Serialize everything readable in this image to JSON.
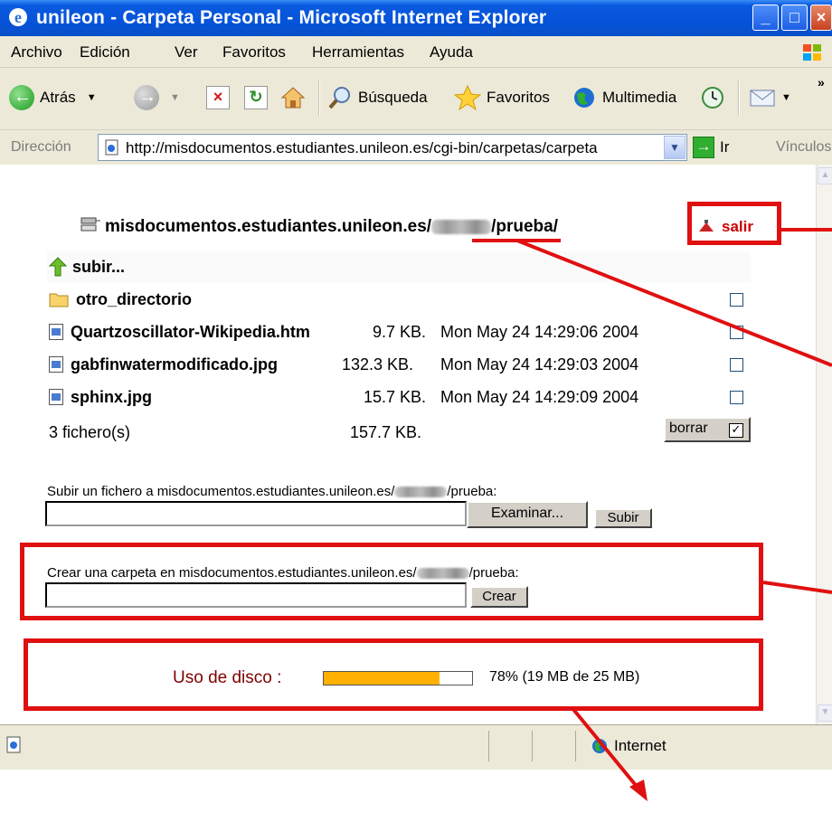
{
  "window": {
    "title": "unileon - Carpeta Personal - Microsoft Internet Explorer"
  },
  "menu": [
    "Archivo",
    "Edición",
    "Ver",
    "Favoritos",
    "Herramientas",
    "Ayuda"
  ],
  "toolbar": {
    "back": "Atrás",
    "search": "Búsqueda",
    "favorites": "Favoritos",
    "media": "Multimedia"
  },
  "address": {
    "label": "Dirección",
    "url": "http://misdocumentos.estudiantes.unileon.es/cgi-bin/carpetas/carpeta",
    "go": "Ir",
    "links": "Vínculos"
  },
  "page": {
    "path_prefix": "misdocumentos.estudiantes.unileon.es/",
    "path_suffix": "/prueba/",
    "logout": "salir",
    "up": "subir...",
    "folder": "otro_directorio",
    "files": [
      {
        "name": "Quartzoscillator-Wikipedia.htm",
        "size": "9.7 KB.",
        "date": "Mon May 24 14:29:06 2004"
      },
      {
        "name": "gabfinwatermodificado.jpg",
        "size": "132.3 KB.",
        "date": "Mon May 24 14:29:03 2004"
      },
      {
        "name": "sphinx.jpg",
        "size": "15.7 KB.",
        "date": "Mon May 24 14:29:09 2004"
      }
    ],
    "count": "3 fichero(s)",
    "total": "157.7 KB.",
    "delete": "borrar",
    "upload_label_a": "Subir un fichero a misdocumentos.estudiantes.unileon.es/",
    "upload_label_b": "/prueba:",
    "browse": "Examinar...",
    "upload": "Subir",
    "mkdir_label_a": "Crear una carpeta en misdocumentos.estudiantes.unileon.es/",
    "mkdir_label_b": "/prueba:",
    "create": "Crear",
    "disk_label": "Uso de disco :",
    "disk_usage_fraction": 0.78,
    "disk_text": "78% (19 MB de 25 MB)"
  },
  "status": {
    "zone": "Internet"
  },
  "colors": {
    "annotation": "#e01010",
    "bar": "#ffb000",
    "disk_label": "#800000"
  }
}
